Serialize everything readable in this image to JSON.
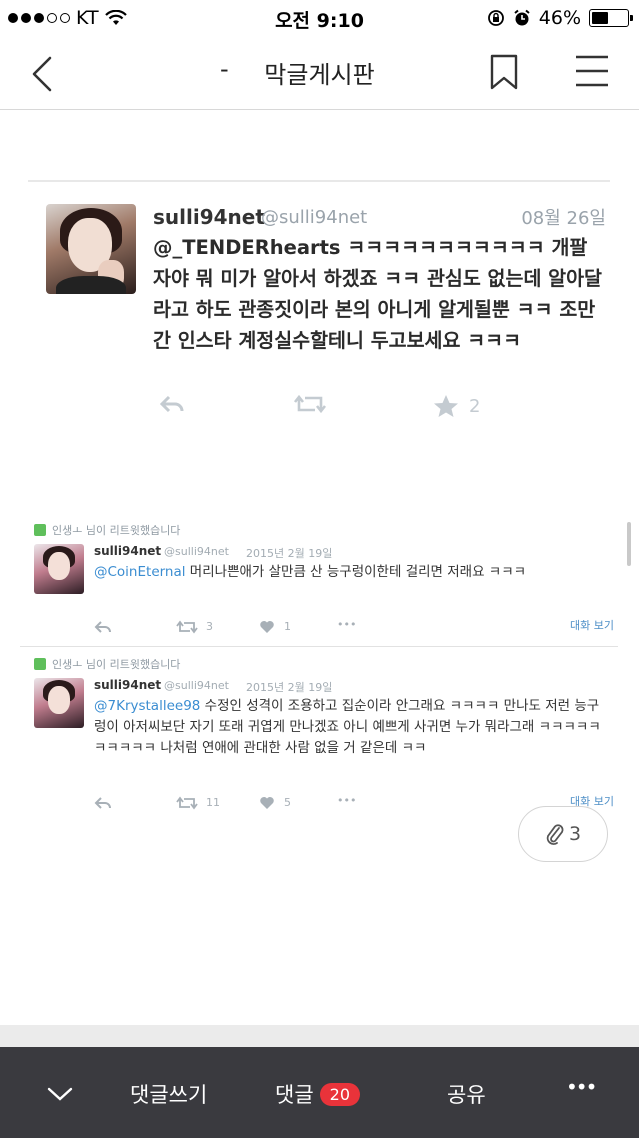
{
  "status_bar": {
    "carrier": "KT",
    "time": "오전 9:10",
    "battery": "46%",
    "battery_level": 0.46
  },
  "nav": {
    "dash": "-",
    "title": "막글게시판"
  },
  "main_tweet": {
    "name": "sulli94net",
    "handle": "@sulli94net",
    "date": "08월 26일",
    "body": "@_TENDERhearts ㅋㅋㅋㅋㅋㅋㅋㅋㅋㅋㅋ 개팔자야 뭐 미가 알아서 하겠죠 ㅋㅋ 관심도 없는데 알아달라고 하도 관종짓이라 본의 아니게 알게될뿐 ㅋㅋ 조만간 인스타 계정실수할테니 두고보세요 ㅋㅋㅋ",
    "favorites": "2"
  },
  "retweets": [
    {
      "retweeted_by": "인생ㅗ 님이 리트윗했습니다",
      "name": "sulli94net",
      "handle": "@sulli94net",
      "date": "2015년 2월 19일",
      "mention": "@CoinEternal",
      "body": " 머리나쁜애가 살만큼 산 능구렁이한테 걸리면 저래요 ㅋㅋㅋ",
      "retweets": "3",
      "likes": "1",
      "view_label": "대화 보기"
    },
    {
      "retweeted_by": "인생ㅗ 님이 리트윗했습니다",
      "name": "sulli94net",
      "handle": "@sulli94net",
      "date": "2015년 2월 19일",
      "mention": "@7Krystallee98",
      "body": " 수정인 성격이 조용하고 집순이라 안그래요 ㅋㅋㅋㅋ 만나도 저런 능구렁이 아저씨보단 자기 또래 귀엽게 만나겠죠 아니 예쁘게 사귀면 누가 뭐라그래 ㅋㅋㅋㅋㅋㅋㅋㅋㅋㅋ 나처럼 연애에 관대한 사람 없을 거 같은데 ㅋㅋ",
      "retweets": "11",
      "likes": "5",
      "view_label": "대화 보기"
    }
  ],
  "attachments": {
    "count": "3",
    "icon": "paperclip-icon"
  },
  "bottom_bar": {
    "write_comment": "댓글쓰기",
    "comments": "댓글",
    "comment_count": "20",
    "share": "공유",
    "more": "•••"
  }
}
